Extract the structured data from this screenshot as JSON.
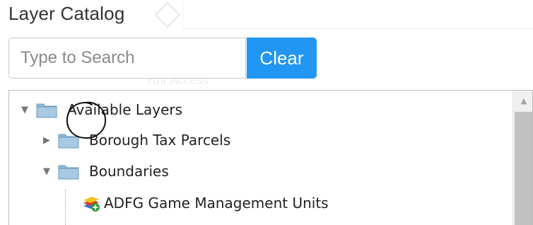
{
  "panel": {
    "title": "Layer Catalog",
    "ghost_text": "Full Access"
  },
  "search": {
    "placeholder": "Type to Search",
    "value": "",
    "clear_label": "Clear"
  },
  "colors": {
    "accent": "#2196f3",
    "folder": "#8fb9d8",
    "annotation": "#111111"
  },
  "tree": {
    "root": {
      "label": "Available Layers",
      "expanded": true,
      "icon": "folder-icon"
    },
    "children": [
      {
        "label": "Borough Tax Parcels",
        "expanded": false,
        "icon": "folder-icon"
      },
      {
        "label": "Boundaries",
        "expanded": true,
        "icon": "folder-icon",
        "children": [
          {
            "label": "ADFG Game Management Units",
            "icon": "add-layer-icon",
            "annotated": true
          }
        ]
      }
    ]
  }
}
